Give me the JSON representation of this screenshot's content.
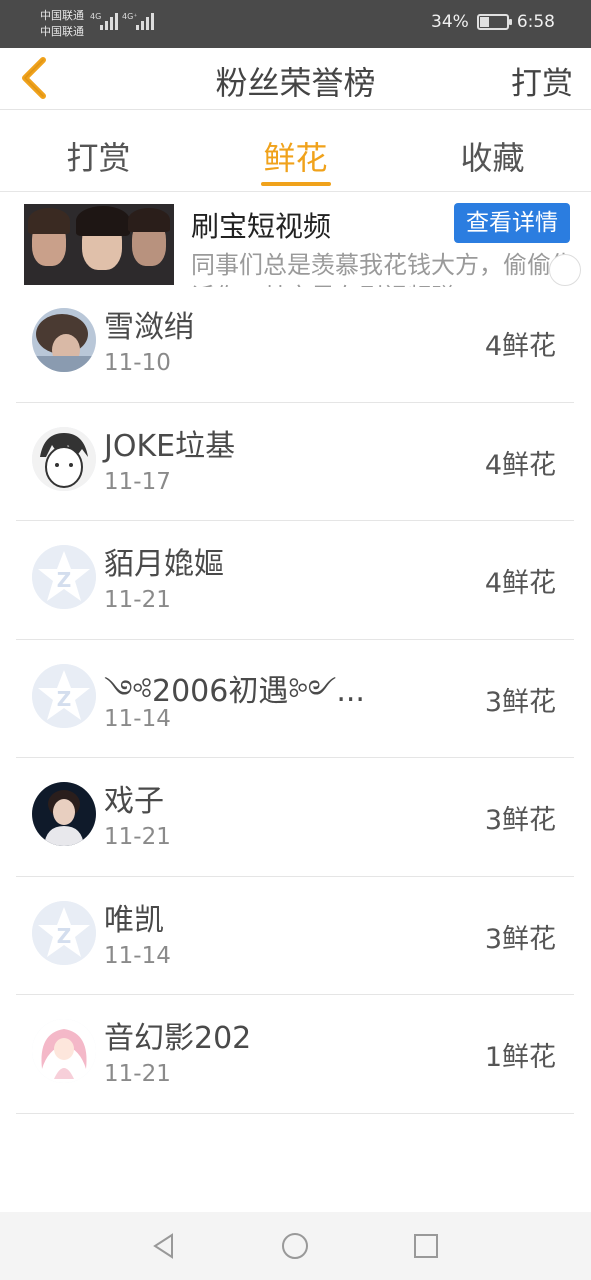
{
  "status_bar": {
    "carrier_1": "中国联通",
    "carrier_2": "中国联通",
    "network_1": "4G",
    "network_2": "4G⁺",
    "battery_percent": "34%",
    "battery_level": 0.34,
    "time": "6:58"
  },
  "header": {
    "title": "粉丝荣誉榜",
    "action_label": "打赏",
    "back_icon": "chevron-left-icon",
    "back_color": "#f0a21b"
  },
  "tabs": [
    {
      "label": "打赏",
      "active": false
    },
    {
      "label": "鲜花",
      "active": true
    },
    {
      "label": "收藏",
      "active": false
    }
  ],
  "accent_color": "#f0a21b",
  "ad": {
    "title": "刷宝短视频",
    "button_label": "查看详情",
    "description": "同事们总是羡慕我花钱大方，偷偷告诉你，其实是在刷视频赚",
    "button_color": "#2b7de0"
  },
  "fans": [
    {
      "name": "雪潋绡",
      "date": "11-10",
      "count": "4鲜花",
      "avatar": "photo"
    },
    {
      "name": "JOKE垃基",
      "date": "11-17",
      "count": "4鲜花",
      "avatar": "sketch"
    },
    {
      "name": "貊月嫓嫗",
      "date": "11-21",
      "count": "4鲜花",
      "avatar": "default"
    },
    {
      "name": "༺2006初遇༻...",
      "date": "11-14",
      "count": "3鲜花",
      "avatar": "default"
    },
    {
      "name": "戏子",
      "date": "11-21",
      "count": "3鲜花",
      "avatar": "photo-dark"
    },
    {
      "name": "唯凯",
      "date": "11-14",
      "count": "3鲜花",
      "avatar": "default"
    },
    {
      "name": "音幻影202",
      "date": "11-21",
      "count": "1鲜花",
      "avatar": "anime"
    }
  ],
  "nav_bar": {
    "back": "triangle-back-icon",
    "home": "circle-home-icon",
    "recents": "square-recents-icon"
  }
}
